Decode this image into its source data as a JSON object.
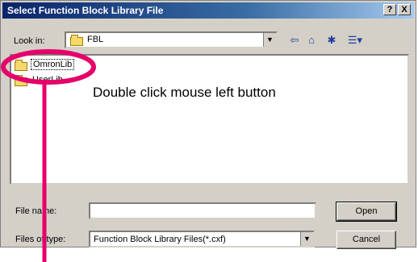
{
  "window": {
    "title": "Select Function Block Library File",
    "help_btn": "?",
    "close_btn": "X"
  },
  "lookin": {
    "label": "Look in:",
    "value": "FBL"
  },
  "toolbar": {
    "back_icon": "back-arrow-icon",
    "up_icon": "up-folder-icon",
    "new_folder_icon": "new-folder-icon",
    "view_icon": "view-menu-icon"
  },
  "files": [
    {
      "name": "OmronLib",
      "selected": true
    },
    {
      "name": "UserLib",
      "selected": false
    }
  ],
  "annotation": {
    "text": "Double click mouse left button",
    "color": "#e5006a"
  },
  "filename": {
    "label": "File name:",
    "value": ""
  },
  "filetype": {
    "label": "Files of type:",
    "value": "Function Block Library Files(*.cxf)"
  },
  "buttons": {
    "open": "Open",
    "cancel": "Cancel"
  }
}
